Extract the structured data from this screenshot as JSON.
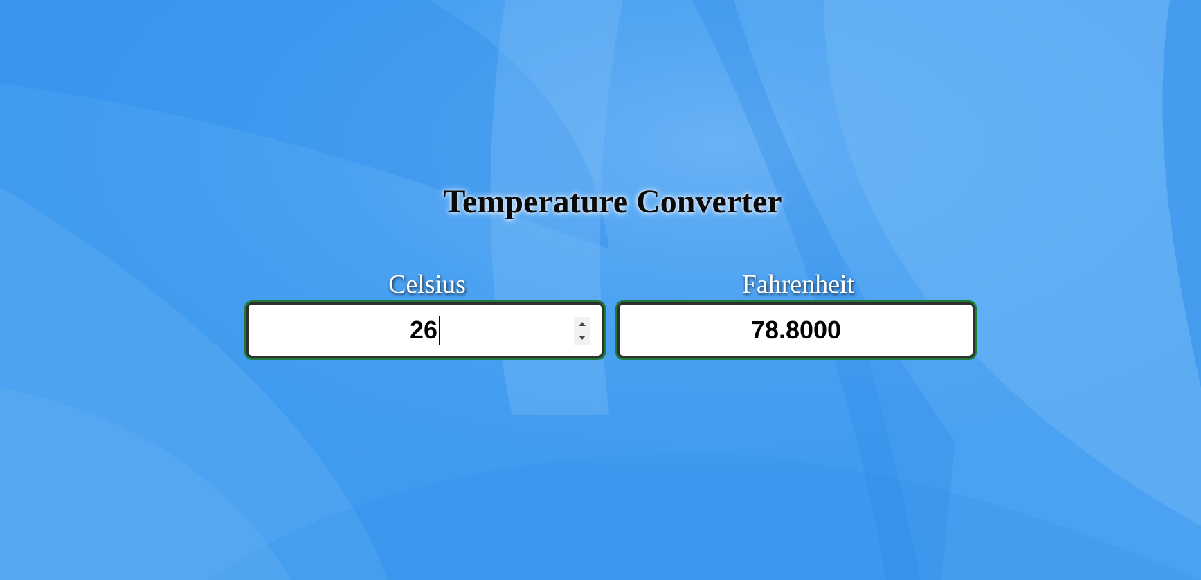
{
  "title": "Temperature Converter",
  "celsius": {
    "label": "Celsius",
    "value": "26"
  },
  "fahrenheit": {
    "label": "Fahrenheit",
    "value": "78.8000"
  },
  "colors": {
    "background": "#3d99f0",
    "input_border_accent": "#1f7a3a",
    "label_text": "#ffffff",
    "title_text": "#0b0b0b"
  }
}
